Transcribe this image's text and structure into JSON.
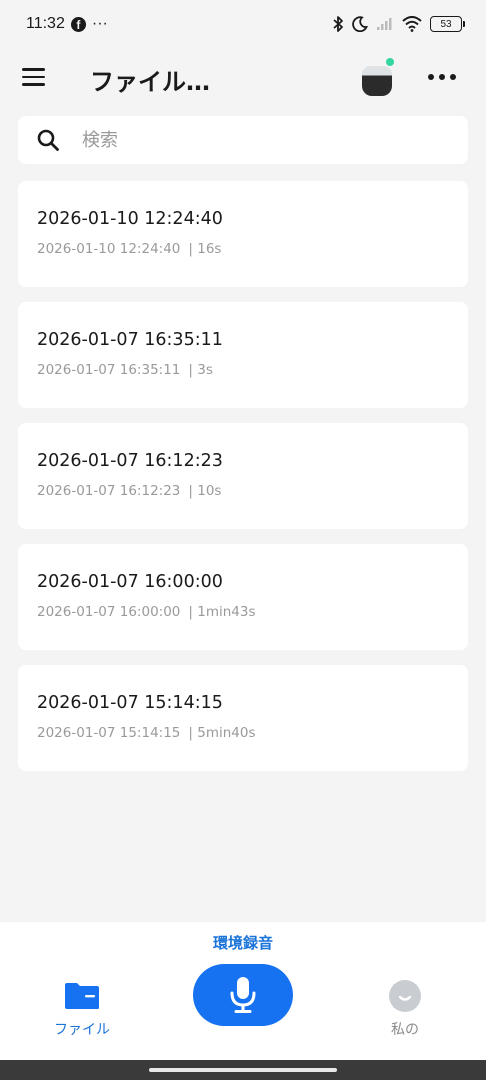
{
  "status_bar": {
    "time": "11:32",
    "overflow": "···",
    "battery": "53",
    "icons": [
      "facebook-icon",
      "bluetooth-icon",
      "moon-icon",
      "signal-icon",
      "wifi-icon",
      "battery-icon"
    ]
  },
  "header": {
    "title": "ファイル…",
    "icons": [
      "menu-icon",
      "device-icon",
      "more-icon"
    ]
  },
  "search": {
    "placeholder": "検索",
    "value": ""
  },
  "recordings": [
    {
      "title": "2026-01-10 12:24:40",
      "date": "2026-01-10 12:24:40",
      "duration": "| 16s"
    },
    {
      "title": "2026-01-07 16:35:11",
      "date": "2026-01-07 16:35:11",
      "duration": "| 3s"
    },
    {
      "title": "2026-01-07 16:12:23",
      "date": "2026-01-07 16:12:23",
      "duration": "| 10s"
    },
    {
      "title": "2026-01-07 16:00:00",
      "date": "2026-01-07 16:00:00",
      "duration": "| 1min43s"
    },
    {
      "title": "2026-01-07 15:14:15",
      "date": "2026-01-07 15:14:15",
      "duration": "| 5min40s"
    }
  ],
  "bottom_nav": {
    "mode_label": "環境録音",
    "files_label": "ファイル",
    "me_label": "私の",
    "accent_color": "#1672f0"
  }
}
